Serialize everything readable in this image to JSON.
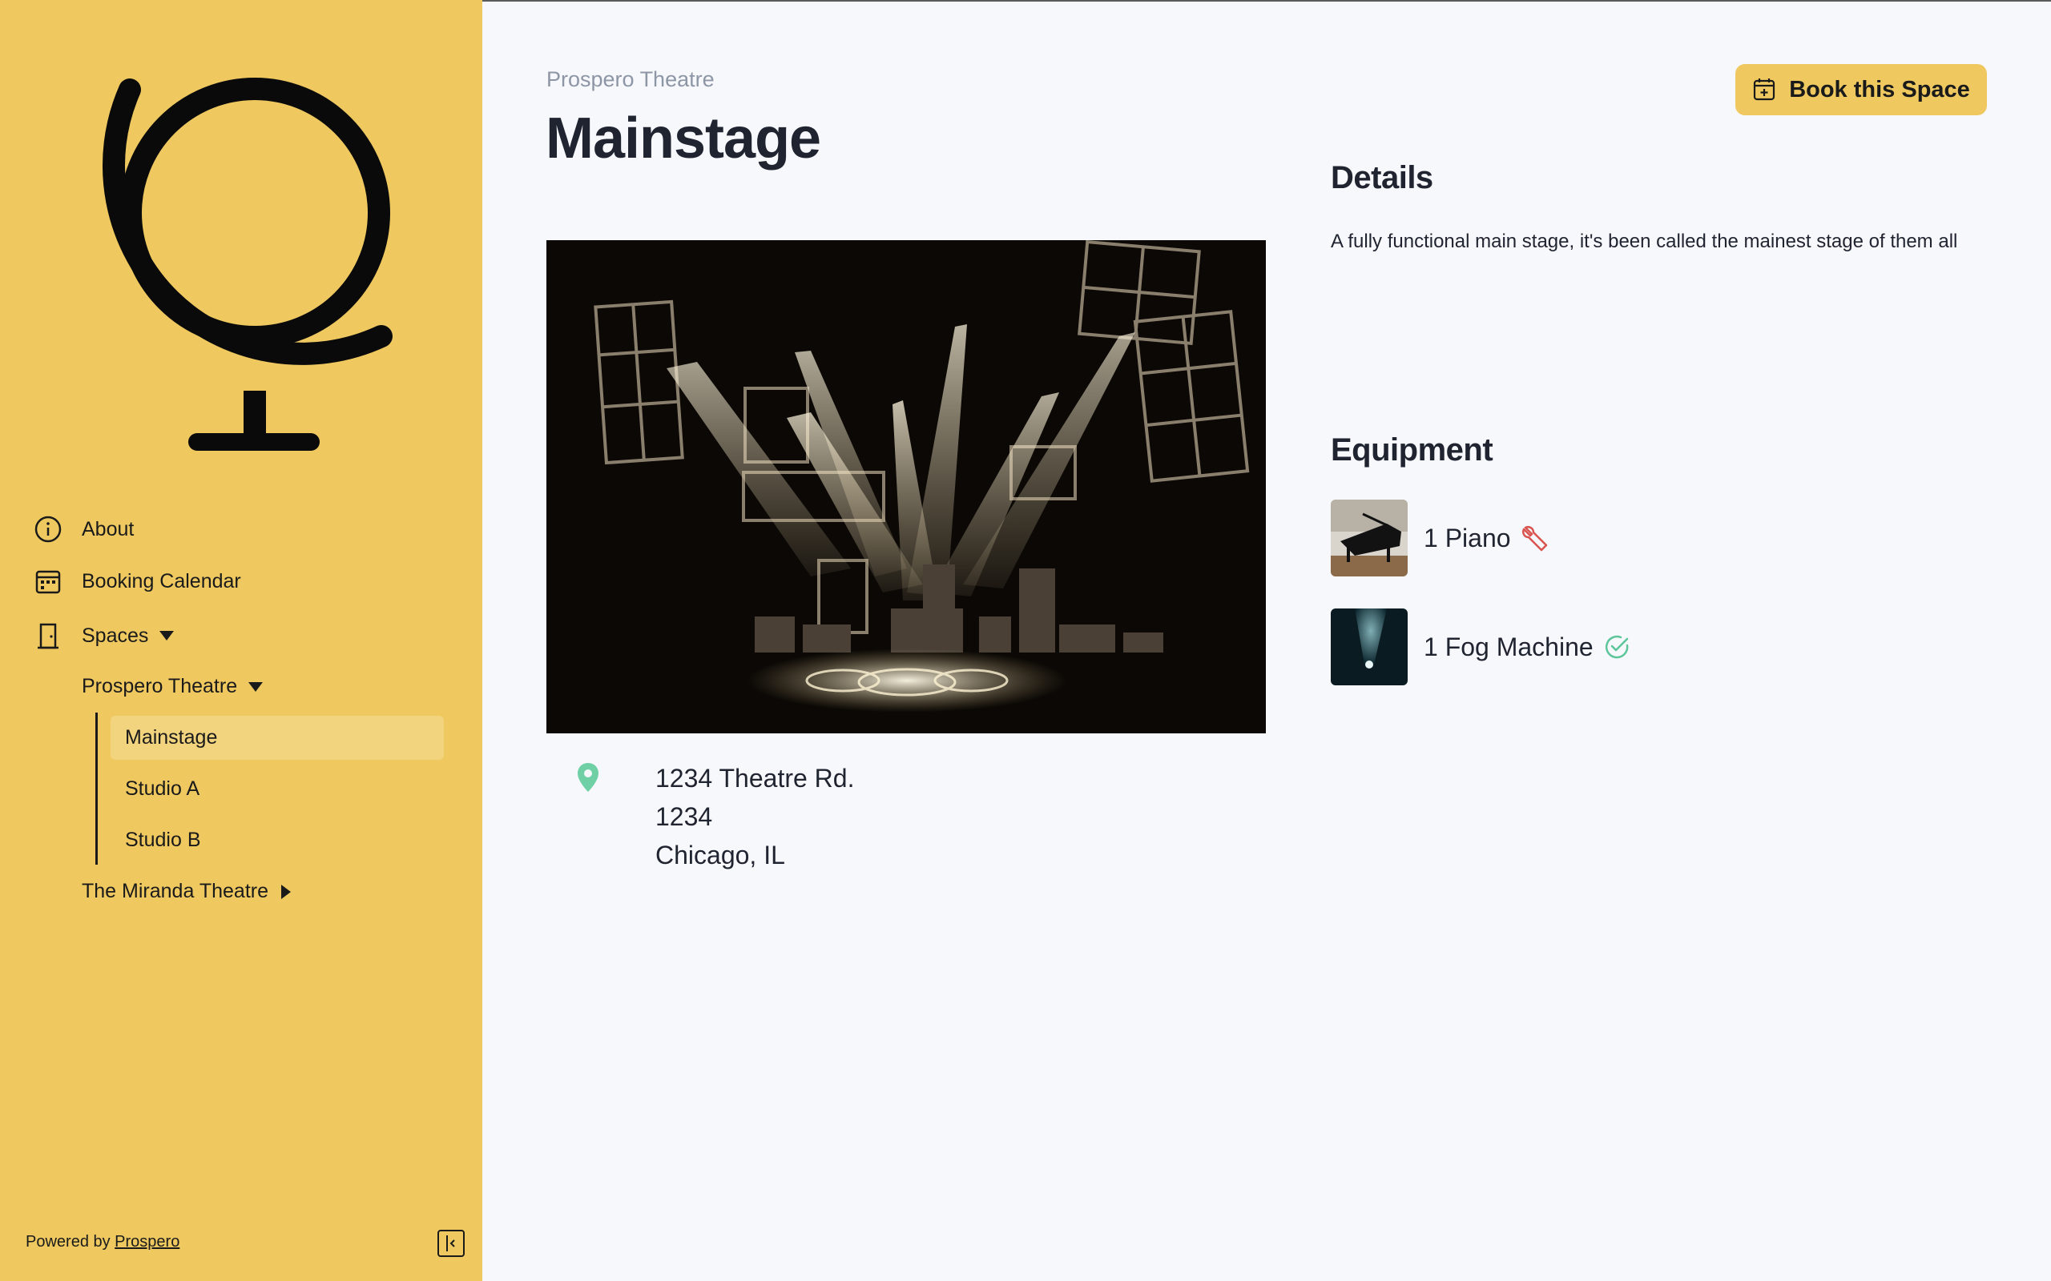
{
  "sidebar": {
    "nav": [
      {
        "label": "About",
        "icon": "info-icon"
      },
      {
        "label": "Booking Calendar",
        "icon": "calendar-icon"
      },
      {
        "label": "Spaces",
        "icon": "door-icon"
      }
    ],
    "venues": [
      {
        "label": "Prospero Theatre",
        "expanded": true
      },
      {
        "label": "The Miranda Theatre",
        "expanded": false
      }
    ],
    "spaces": [
      {
        "label": "Mainstage",
        "active": true
      },
      {
        "label": "Studio A",
        "active": false
      },
      {
        "label": "Studio B",
        "active": false
      }
    ],
    "footer": {
      "prefix": "Powered by ",
      "link": "Prospero"
    }
  },
  "main": {
    "breadcrumb": "Prospero Theatre",
    "title": "Mainstage",
    "book_button": "Book this Space",
    "address": [
      "1234 Theatre Rd.",
      "1234",
      "Chicago, IL"
    ],
    "details": {
      "title": "Details",
      "text": "A fully functional main stage, it's been called the mainest stage of them all"
    },
    "equipment": {
      "title": "Equipment",
      "items": [
        {
          "label": "1 Piano",
          "status_icon": "wrench-icon",
          "status_color": "#d9534f"
        },
        {
          "label": "1 Fog Machine",
          "status_icon": "check-circle-icon",
          "status_color": "#5cc59a"
        }
      ]
    }
  },
  "colors": {
    "sidebar": "#efc960",
    "accent": "#efc960",
    "pin": "#6fcfa5",
    "background": "#f7f8fb"
  }
}
